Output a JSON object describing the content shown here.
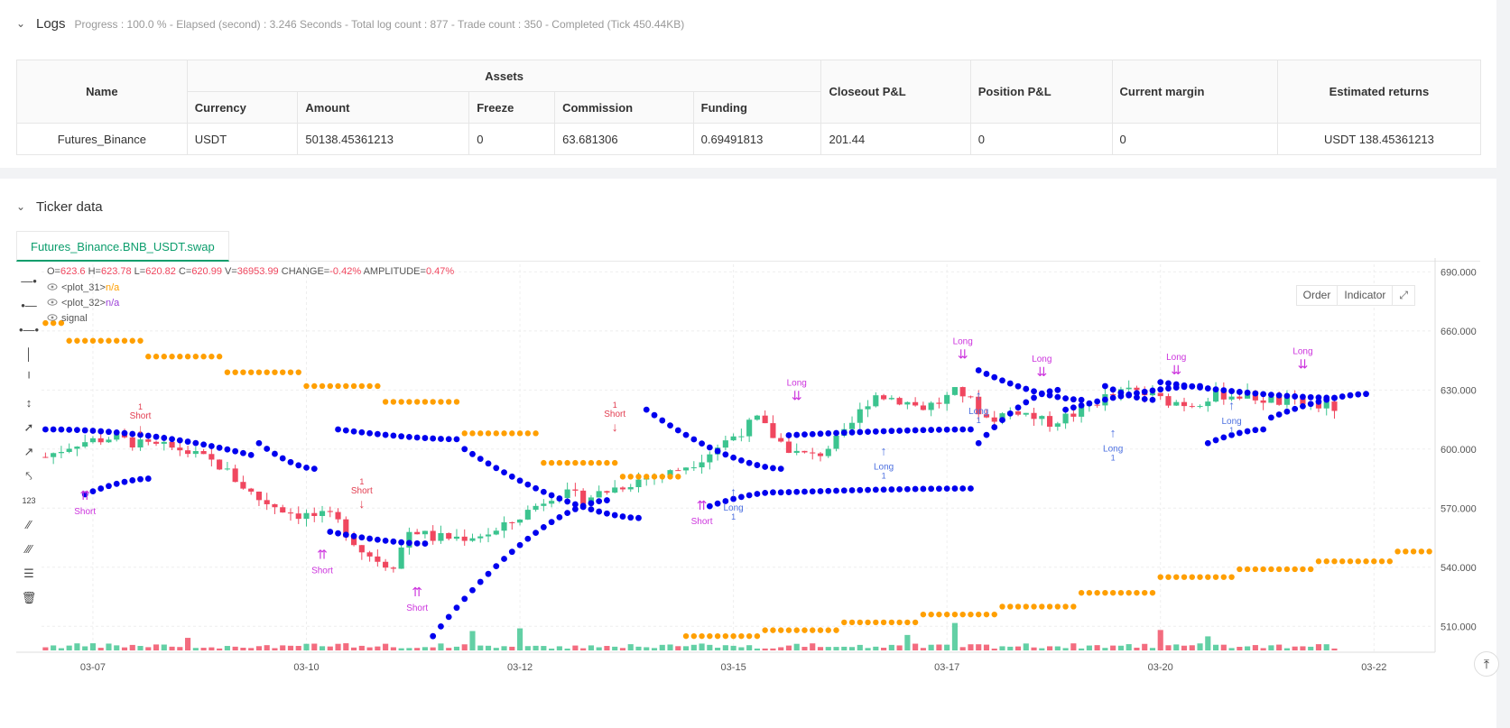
{
  "logs": {
    "title": "Logs",
    "status": "Progress : 100.0 % - Elapsed (second) : 3.246  Seconds - Total log count : 877 - Trade count : 350 - Completed (Tick 450.44KB)",
    "table": {
      "headers": {
        "name": "Name",
        "assets": "Assets",
        "currency": "Currency",
        "amount": "Amount",
        "freeze": "Freeze",
        "commission": "Commission",
        "funding": "Funding",
        "closeout": "Closeout P&L",
        "position": "Position P&L",
        "margin": "Current margin",
        "returns": "Estimated returns"
      },
      "row": {
        "name": "Futures_Binance",
        "currency": "USDT",
        "amount": "50138.45361213",
        "freeze": "0",
        "commission": "63.681306",
        "funding": "0.69491813",
        "closeout": "201.44",
        "position": "0",
        "margin": "0",
        "returns": "USDT 138.45361213"
      }
    }
  },
  "ticker": {
    "title": "Ticker data",
    "tab": "Futures_Binance.BNB_USDT.swap",
    "buttons": {
      "order": "Order",
      "indicator": "Indicator"
    },
    "legend": {
      "ohlc_o_label": "O=",
      "ohlc_o": "623.6",
      "ohlc_h_label": "H=",
      "ohlc_h": "623.78",
      "ohlc_l_label": "L=",
      "ohlc_l": "620.82",
      "ohlc_c_label": "C=",
      "ohlc_c": "620.99",
      "ohlc_v_label": "V=",
      "ohlc_v": "36953.99",
      "change_label": "CHANGE=",
      "change": "-0.42%",
      "amp_label": "AMPLITUDE=",
      "amp": "0.47%",
      "plot31": "<plot_31>",
      "plot31_val": "n/a",
      "plot32": "<plot_32>",
      "plot32_val": "n/a",
      "signal": "signal"
    }
  },
  "colors": {
    "up": "#3cc48f",
    "down": "#f0475f",
    "blue_dots": "#0000ee",
    "orange_dots": "#ff9f00",
    "signal": "#cc33dd",
    "long": "#4b6fe0",
    "short": "#e23d50"
  },
  "chart_data": {
    "type": "candlestick",
    "x_ticks": [
      "03-07",
      "03-10",
      "03-12",
      "03-15",
      "03-17",
      "03-20",
      "03-22"
    ],
    "y_ticks": [
      "690.000",
      "660.000",
      "630.000",
      "600.000",
      "570.000",
      "540.000",
      "510.000"
    ],
    "ylim": [
      490,
      692
    ],
    "close_path": [
      [
        0,
        596
      ],
      [
        3,
        603
      ],
      [
        7,
        606
      ],
      [
        10,
        602
      ],
      [
        14,
        600
      ],
      [
        18,
        592
      ],
      [
        22,
        575
      ],
      [
        26,
        567
      ],
      [
        30,
        565
      ],
      [
        33,
        548
      ],
      [
        36,
        540
      ],
      [
        38,
        560
      ],
      [
        40,
        555
      ],
      [
        43,
        555
      ],
      [
        47,
        558
      ],
      [
        50,
        568
      ],
      [
        53,
        578
      ],
      [
        56,
        575
      ],
      [
        59,
        580
      ],
      [
        62,
        585
      ],
      [
        65,
        588
      ],
      [
        68,
        595
      ],
      [
        71,
        605
      ],
      [
        74,
        615
      ],
      [
        76,
        605
      ],
      [
        78,
        598
      ],
      [
        80,
        596
      ],
      [
        83,
        607
      ],
      [
        86,
        628
      ],
      [
        89,
        625
      ],
      [
        91,
        621
      ],
      [
        93,
        624
      ],
      [
        95,
        630
      ],
      [
        98,
        615
      ],
      [
        101,
        620
      ],
      [
        104,
        613
      ],
      [
        107,
        618
      ],
      [
        110,
        626
      ],
      [
        113,
        630
      ],
      [
        116,
        625
      ],
      [
        119,
        623
      ],
      [
        122,
        628
      ],
      [
        125,
        627
      ],
      [
        128,
        624
      ],
      [
        131,
        623
      ],
      [
        134,
        621
      ]
    ],
    "blue_upper": [
      {
        "x0": 0,
        "x1": 26,
        "y0": 610,
        "y1": 597,
        "curve": "arc_down"
      },
      {
        "x0": 27,
        "x1": 34,
        "y0": 603,
        "y1": 590
      },
      {
        "x0": 37,
        "x1": 52,
        "y0": 610,
        "y1": 605
      },
      {
        "x0": 53,
        "x1": 75,
        "y0": 600,
        "y1": 565
      },
      {
        "x0": 76,
        "x1": 93,
        "y0": 620,
        "y1": 590
      },
      {
        "x0": 94,
        "x1": 117,
        "y0": 607,
        "y1": 610
      },
      {
        "x0": 118,
        "x1": 131,
        "y0": 640,
        "y1": 625
      },
      {
        "x0": 134,
        "x1": 140,
        "y0": 632,
        "y1": 625
      },
      {
        "x0": 141,
        "x1": 163,
        "y0": 634,
        "y1": 626
      }
    ],
    "blue_lower": [
      {
        "x0": 5,
        "x1": 13,
        "y0": 577,
        "y1": 585
      },
      {
        "x0": 36,
        "x1": 48,
        "y0": 558,
        "y1": 552
      },
      {
        "x0": 49,
        "x1": 71,
        "y0": 505,
        "y1": 574
      },
      {
        "x0": 84,
        "x1": 92,
        "y0": 571,
        "y1": 578
      },
      {
        "x0": 93,
        "x1": 117,
        "y0": 578,
        "y1": 580
      },
      {
        "x0": 118,
        "x1": 128,
        "y0": 603,
        "y1": 630
      },
      {
        "x0": 129,
        "x1": 146,
        "y0": 620,
        "y1": 632
      },
      {
        "x0": 147,
        "x1": 154,
        "y0": 603,
        "y1": 610
      },
      {
        "x0": 155,
        "x1": 167,
        "y0": 616,
        "y1": 628
      }
    ],
    "orange_steps": [
      {
        "x0": 0,
        "x1": 2,
        "y": 664
      },
      {
        "x0": 3,
        "x1": 12,
        "y": 655
      },
      {
        "x0": 13,
        "x1": 22,
        "y": 647
      },
      {
        "x0": 23,
        "x1": 32,
        "y": 639
      },
      {
        "x0": 33,
        "x1": 42,
        "y": 632
      },
      {
        "x0": 43,
        "x1": 52,
        "y": 624
      },
      {
        "x0": 53,
        "x1": 62,
        "y": 608
      },
      {
        "x0": 63,
        "x1": 72,
        "y": 593
      },
      {
        "x0": 73,
        "x1": 80,
        "y": 586
      },
      {
        "x0": 81,
        "x1": 90,
        "y": 505
      },
      {
        "x0": 91,
        "x1": 100,
        "y": 508
      },
      {
        "x0": 101,
        "x1": 110,
        "y": 512
      },
      {
        "x0": 111,
        "x1": 120,
        "y": 516
      },
      {
        "x0": 121,
        "x1": 130,
        "y": 520
      },
      {
        "x0": 131,
        "x1": 140,
        "y": 527
      },
      {
        "x0": 141,
        "x1": 150,
        "y": 535
      },
      {
        "x0": 151,
        "x1": 160,
        "y": 539
      },
      {
        "x0": 161,
        "x1": 170,
        "y": 543
      },
      {
        "x0": 171,
        "x1": 175,
        "y": 548
      }
    ],
    "labels": [
      {
        "text": "Short",
        "bar": 5,
        "price": 577,
        "kind": "signal_up"
      },
      {
        "text": "Short",
        "bar": 12,
        "price": 609,
        "kind": "short_down"
      },
      {
        "text": "Short",
        "bar": 35,
        "price": 547,
        "kind": "signal_up"
      },
      {
        "text": "Short",
        "bar": 40,
        "price": 571,
        "kind": "short_down"
      },
      {
        "text": "Short",
        "bar": 47,
        "price": 528,
        "kind": "signal_up"
      },
      {
        "text": "Short",
        "bar": 72,
        "price": 610,
        "kind": "short_down"
      },
      {
        "text": "Short",
        "bar": 83,
        "price": 572,
        "kind": "signal_up"
      },
      {
        "text": "Long",
        "bar": 87,
        "price": 576,
        "kind": "long_up"
      },
      {
        "text": "Long",
        "bar": 95,
        "price": 624,
        "kind": "signal_down"
      },
      {
        "text": "Long",
        "bar": 106,
        "price": 597,
        "kind": "long_up"
      },
      {
        "text": "Long",
        "bar": 116,
        "price": 645,
        "kind": "signal_down"
      },
      {
        "text": "Long",
        "bar": 118,
        "price": 625,
        "kind": "long_up"
      },
      {
        "text": "Long",
        "bar": 126,
        "price": 636,
        "kind": "signal_down"
      },
      {
        "text": "Long",
        "bar": 135,
        "price": 606,
        "kind": "long_up"
      },
      {
        "text": "Long",
        "bar": 143,
        "price": 637,
        "kind": "signal_down"
      },
      {
        "text": "Long",
        "bar": 150,
        "price": 620,
        "kind": "long_up"
      },
      {
        "text": "Long",
        "bar": 159,
        "price": 640,
        "kind": "signal_down"
      }
    ]
  }
}
